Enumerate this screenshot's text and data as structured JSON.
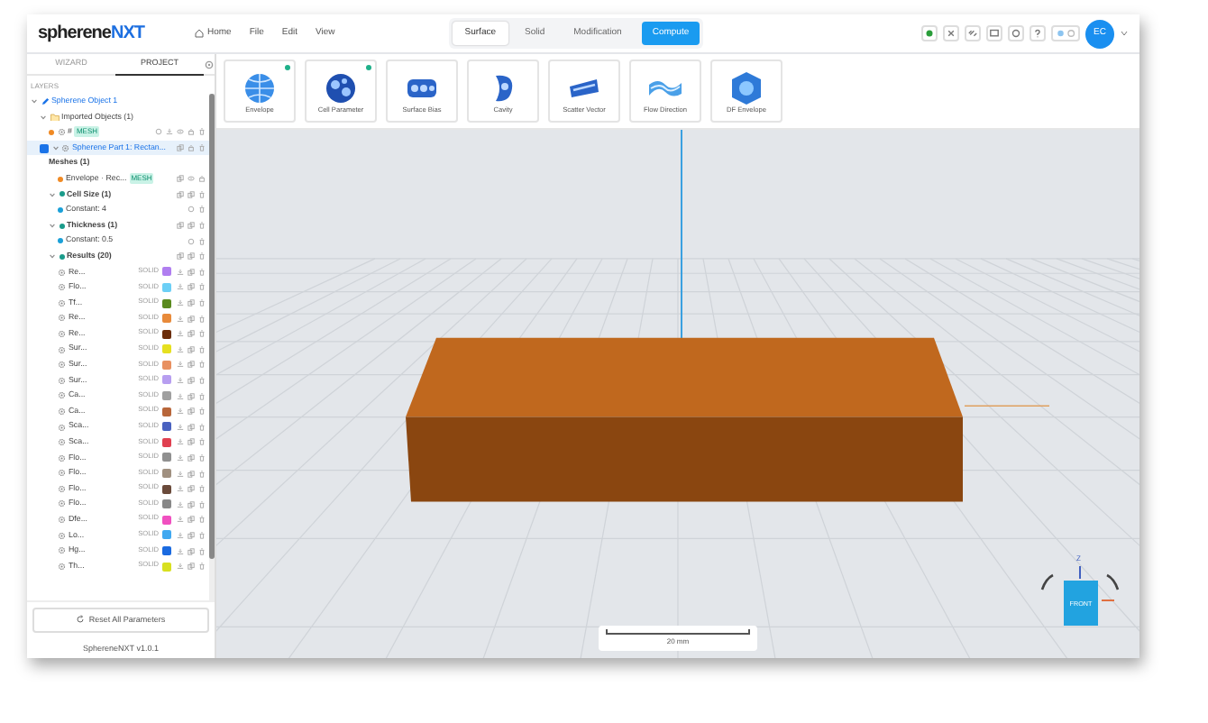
{
  "app": {
    "logo_main": "spherene",
    "logo_accent": "NXT",
    "version": "SphereneNXT v1.0.1"
  },
  "menu": [
    {
      "label": "Home",
      "kind": "home"
    },
    {
      "label": "File",
      "kind": "plain"
    },
    {
      "label": "Edit",
      "kind": "plain"
    },
    {
      "label": "View",
      "kind": "plain"
    }
  ],
  "mode_tabs": [
    {
      "label": "Surface",
      "selected": true
    },
    {
      "label": "Solid",
      "selected": false
    },
    {
      "label": "Modification",
      "selected": false
    }
  ],
  "compute_button": "Compute",
  "user": {
    "initials": "EC"
  },
  "panel_tabs": [
    {
      "label": "WIZARD",
      "selected": false
    },
    {
      "label": "PROJECT",
      "selected": true
    }
  ],
  "layers_heading": "LAYERS",
  "tree": [
    {
      "label": "Spherene Object 1",
      "kind": "object",
      "expanded": true,
      "children": [
        {
          "label": "Imported Objects (1)",
          "kind": "folder",
          "expanded": true,
          "children": [
            {
              "label": "#",
              "kind": "mesh",
              "badge": "MESH"
            }
          ]
        },
        {
          "label": "Spherene Part 1: Rectan...",
          "kind": "part",
          "checked": true,
          "expanded": true,
          "children": [
            {
              "label": "Meshes (1)",
              "kind": "heading",
              "children": [
                {
                  "label": "Envelope · Rec...",
                  "kind": "mesh",
                  "badge": "MESH"
                }
              ]
            },
            {
              "label": "Cell Size (1)",
              "kind": "group",
              "expanded": true,
              "children": [
                {
                  "label": "Constant: 4",
                  "kind": "param"
                }
              ]
            },
            {
              "label": "Thickness (1)",
              "kind": "group",
              "expanded": true,
              "children": [
                {
                  "label": "Constant: 0.5",
                  "kind": "param"
                }
              ]
            },
            {
              "label": "Results (20)",
              "kind": "group",
              "expanded": true,
              "children": [
                {
                  "label": "Re...",
                  "kind": "result",
                  "badge": "SOLID",
                  "color": "#b07ef0"
                },
                {
                  "label": "Flo...",
                  "kind": "result",
                  "badge": "SOLID",
                  "color": "#6ccff6"
                },
                {
                  "label": "Tf...",
                  "kind": "result",
                  "badge": "SOLID",
                  "color": "#5a8a1e"
                },
                {
                  "label": "Re...",
                  "kind": "result",
                  "badge": "SOLID",
                  "color": "#e88a3a"
                },
                {
                  "label": "Re...",
                  "kind": "result",
                  "badge": "SOLID",
                  "color": "#6b2d0a"
                },
                {
                  "label": "Sur...",
                  "kind": "result",
                  "badge": "SOLID",
                  "color": "#e6e020"
                },
                {
                  "label": "Sur...",
                  "kind": "result",
                  "badge": "SOLID",
                  "color": "#e89060"
                },
                {
                  "label": "Sur...",
                  "kind": "result",
                  "badge": "SOLID",
                  "color": "#b79ef0"
                },
                {
                  "label": "Ca...",
                  "kind": "result",
                  "badge": "SOLID",
                  "color": "#a0a0a0"
                },
                {
                  "label": "Ca...",
                  "kind": "result",
                  "badge": "SOLID",
                  "color": "#b8663a"
                },
                {
                  "label": "Sca...",
                  "kind": "result",
                  "badge": "SOLID",
                  "color": "#4a62c0"
                },
                {
                  "label": "Sca...",
                  "kind": "result",
                  "badge": "SOLID",
                  "color": "#e04050"
                },
                {
                  "label": "Flo...",
                  "kind": "result",
                  "badge": "SOLID",
                  "color": "#909090"
                },
                {
                  "label": "Flo...",
                  "kind": "result",
                  "badge": "SOLID",
                  "color": "#a09080"
                },
                {
                  "label": "Flo...",
                  "kind": "result",
                  "badge": "SOLID",
                  "color": "#6a4a3a"
                },
                {
                  "label": "Flo...",
                  "kind": "result",
                  "badge": "SOLID",
                  "color": "#888888"
                },
                {
                  "label": "Dfe...",
                  "kind": "result",
                  "badge": "SOLID",
                  "color": "#f050c0"
                },
                {
                  "label": "Lo...",
                  "kind": "result",
                  "badge": "SOLID",
                  "color": "#40a8f0"
                },
                {
                  "label": "Hg...",
                  "kind": "result",
                  "badge": "SOLID",
                  "color": "#1a6ae0"
                },
                {
                  "label": "Th...",
                  "kind": "result",
                  "badge": "SOLID",
                  "color": "#d8e020"
                }
              ]
            }
          ]
        }
      ]
    }
  ],
  "reset_button": "Reset All Parameters",
  "tools": [
    {
      "label": "Envelope",
      "marked": true
    },
    {
      "label": "Cell Parameter",
      "marked": true
    },
    {
      "label": "Surface Bias",
      "marked": false
    },
    {
      "label": "Cavity",
      "marked": false
    },
    {
      "label": "Scatter Vector",
      "marked": false
    },
    {
      "label": "Flow Direction",
      "marked": false
    },
    {
      "label": "DF Envelope",
      "marked": false
    }
  ],
  "scale_bar": {
    "label": "20 mm"
  },
  "view_cube": {
    "face": "FRONT",
    "axis": "Z"
  }
}
